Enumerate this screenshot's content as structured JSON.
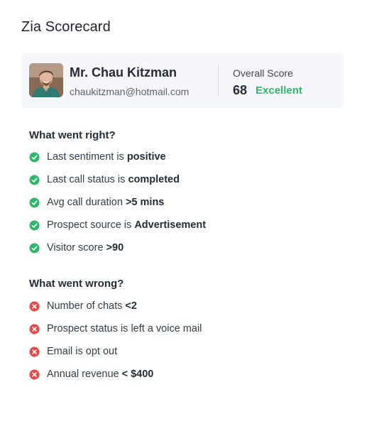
{
  "page": {
    "title": "Zia Scorecard"
  },
  "profile": {
    "name": "Mr. Chau Kitzman",
    "email": "chaukitzman@hotmail.com",
    "score_label": "Overall Score",
    "score_value": "68",
    "score_status": "Excellent"
  },
  "right": {
    "title": "What went right?",
    "items": [
      {
        "label": "Last sentiment is ",
        "value": "positive"
      },
      {
        "label": "Last call status is ",
        "value": "completed"
      },
      {
        "label": "Avg call duration ",
        "value": ">5 mins"
      },
      {
        "label": "Prospect source is ",
        "value": "Advertisement"
      },
      {
        "label": "Visitor score ",
        "value": ">90"
      }
    ]
  },
  "wrong": {
    "title": "What went wrong?",
    "items": [
      {
        "label": "Number of chats ",
        "value": "<2"
      },
      {
        "label": "Prospect status is left a voice mail",
        "value": ""
      },
      {
        "label": "Email is opt out",
        "value": ""
      },
      {
        "label": "Annual revenue ",
        "value": "< $400"
      }
    ]
  },
  "colors": {
    "good": "#31b76b",
    "bad": "#e84747"
  },
  "icons": {
    "good": "check-circle-icon",
    "bad": "x-circle-icon"
  }
}
